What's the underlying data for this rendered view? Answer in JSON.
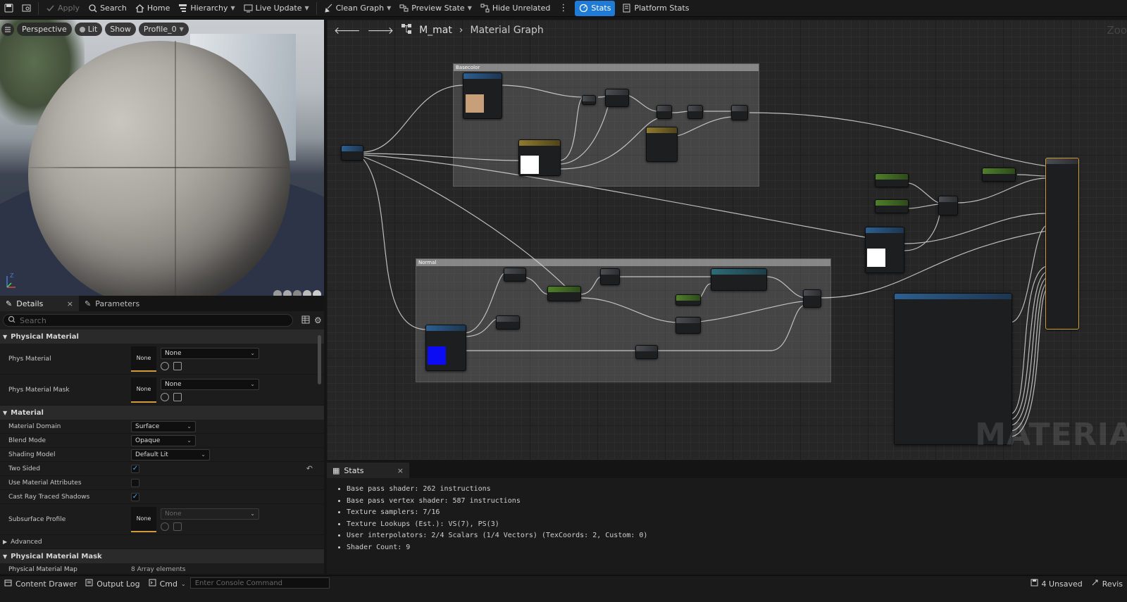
{
  "toolbar": {
    "apply": "Apply",
    "search": "Search",
    "home": "Home",
    "hierarchy": "Hierarchy",
    "live_update": "Live Update",
    "clean_graph": "Clean Graph",
    "preview_state": "Preview State",
    "hide_unrelated": "Hide Unrelated",
    "stats": "Stats",
    "platform_stats": "Platform Stats"
  },
  "viewport": {
    "perspective": "Perspective",
    "lit": "Lit",
    "show": "Show",
    "profile": "Profile_0"
  },
  "details": {
    "tab_details": "Details",
    "tab_parameters": "Parameters",
    "search_placeholder": "Search",
    "categories": {
      "physical_material": "Physical Material",
      "material": "Material",
      "advanced": "Advanced",
      "physical_material_mask": "Physical Material Mask"
    },
    "rows": {
      "phys_material": {
        "label": "Phys Material",
        "thumb": "None",
        "value": "None"
      },
      "phys_material_mask": {
        "label": "Phys Material Mask",
        "thumb": "None",
        "value": "None"
      },
      "material_domain": {
        "label": "Material Domain",
        "value": "Surface"
      },
      "blend_mode": {
        "label": "Blend Mode",
        "value": "Opaque"
      },
      "shading_model": {
        "label": "Shading Model",
        "value": "Default Lit"
      },
      "two_sided": {
        "label": "Two Sided",
        "checked": true
      },
      "use_material_attributes": {
        "label": "Use Material Attributes",
        "checked": false
      },
      "cast_ray_traced_shadows": {
        "label": "Cast Ray Traced Shadows",
        "checked": true
      },
      "subsurface_profile": {
        "label": "Subsurface Profile",
        "thumb": "None",
        "value": "None"
      },
      "physical_material_map": {
        "label": "Physical Material Map",
        "value": "8 Array elements"
      }
    }
  },
  "graph": {
    "asset": "M_mat",
    "title": "Material Graph",
    "zoom": "Zoo",
    "comments": {
      "basecolor": "Basecolor",
      "normal": "Normal"
    },
    "watermark": "MATERIA"
  },
  "stats": {
    "tab": "Stats",
    "lines": [
      "Base pass shader: 262 instructions",
      "Base pass vertex shader: 587 instructions",
      "Texture samplers: 7/16",
      "Texture Lookups (Est.): VS(7), PS(3)",
      "User interpolators: 2/4 Scalars (1/4 Vectors) (TexCoords: 2, Custom: 0)",
      "Shader Count: 9"
    ]
  },
  "statusbar": {
    "content_drawer": "Content Drawer",
    "output_log": "Output Log",
    "cmd": "Cmd",
    "console_placeholder": "Enter Console Command",
    "unsaved": "4 Unsaved",
    "revision": "Revis"
  },
  "colors": {
    "accent": "#1f7bd6",
    "thumb_underline": "#d19a3a",
    "check": "#4aa3ff"
  }
}
